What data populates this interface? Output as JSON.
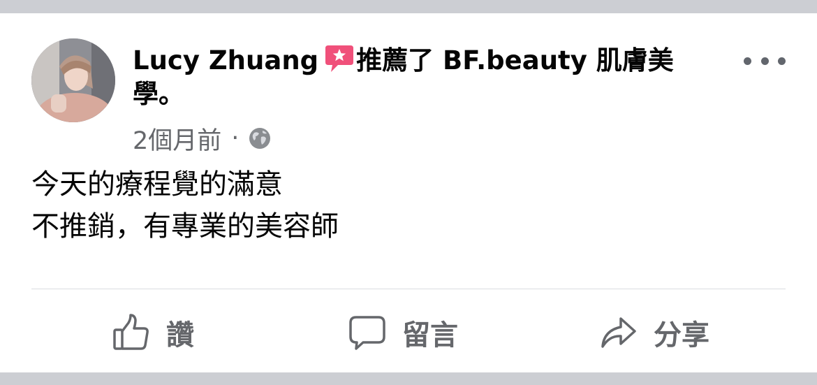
{
  "post": {
    "author": "Lucy Zhuang",
    "recommend_verb": "推薦了",
    "page_name": "BF.beauty 肌膚美學",
    "end_punct": "。",
    "timestamp": "2個月前",
    "separator": "·",
    "privacy_icon": "globe-icon",
    "body_lines": [
      "今天的療程覺的滿意",
      "不推銷，有專業的美容師"
    ]
  },
  "actions": {
    "like_label": "讚",
    "comment_label": "留言",
    "share_label": "分享"
  },
  "icons": {
    "recommend": "recommend-star-icon",
    "more": "more-options-icon",
    "like": "thumbs-up-icon",
    "comment": "speech-bubble-icon",
    "share": "share-arrow-icon"
  },
  "colors": {
    "background": "#ccced3",
    "card": "#ffffff",
    "text_primary": "#050505",
    "text_secondary": "#65676b",
    "recommend_accent": "#f0507a",
    "divider": "#dadde1"
  }
}
